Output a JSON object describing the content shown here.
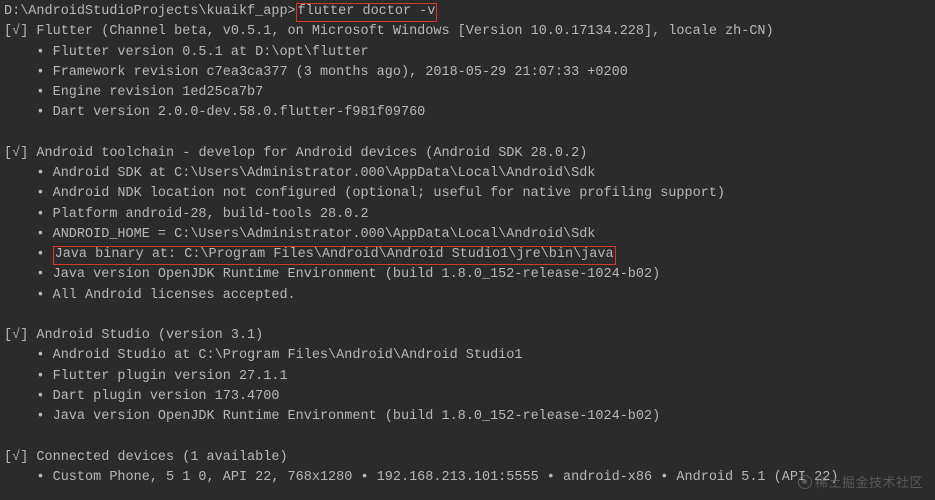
{
  "prompt": {
    "path": "D:\\AndroidStudioProjects\\kuaikf_app>",
    "command": "flutter doctor -v"
  },
  "sections": [
    {
      "status": "[√]",
      "title": " Flutter (Channel beta, v0.5.1, on Microsoft Windows [Version 10.0.17134.228], locale zh-CN)",
      "items": [
        {
          "text": "    • Flutter version 0.5.1 at D:\\opt\\flutter"
        },
        {
          "text": "    • Framework revision c7ea3ca377 (3 months ago), 2018-05-29 21:07:33 +0200"
        },
        {
          "text": "    • Engine revision 1ed25ca7b7"
        },
        {
          "text": "    • Dart version 2.0.0-dev.58.0.flutter-f981f09760"
        }
      ]
    },
    {
      "status": "[√]",
      "title": " Android toolchain - develop for Android devices (Android SDK 28.0.2)",
      "items": [
        {
          "text": "    • Android SDK at C:\\Users\\Administrator.000\\AppData\\Local\\Android\\Sdk"
        },
        {
          "text": "    • Android NDK location not configured (optional; useful for native profiling support)"
        },
        {
          "text": "    • Platform android-28, build-tools 28.0.2"
        },
        {
          "text": "    • ANDROID_HOME = C:\\Users\\Administrator.000\\AppData\\Local\\Android\\Sdk"
        },
        {
          "prefix": "    • ",
          "highlighted": "Java binary at: C:\\Program Files\\Android\\Android Studio1\\jre\\bin\\java"
        },
        {
          "text": "    • Java version OpenJDK Runtime Environment (build 1.8.0_152-release-1024-b02)"
        },
        {
          "text": "    • All Android licenses accepted."
        }
      ]
    },
    {
      "status": "[√]",
      "title": " Android Studio (version 3.1)",
      "items": [
        {
          "text": "    • Android Studio at C:\\Program Files\\Android\\Android Studio1"
        },
        {
          "text": "    • Flutter plugin version 27.1.1"
        },
        {
          "text": "    • Dart plugin version 173.4700"
        },
        {
          "text": "    • Java version OpenJDK Runtime Environment (build 1.8.0_152-release-1024-b02)"
        }
      ]
    },
    {
      "status": "[√]",
      "title": " Connected devices (1 available)",
      "items": [
        {
          "text": "    • Custom Phone, 5 1 0, API 22, 768x1280 • 192.168.213.101:5555 • android-x86 • Android 5.1 (API 22)"
        }
      ]
    }
  ],
  "watermark": "稀土掘金技术社区"
}
